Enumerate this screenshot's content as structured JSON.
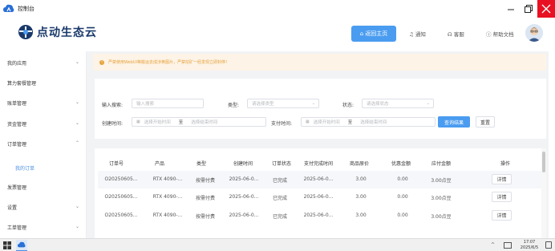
{
  "window": {
    "title": "控制台"
  },
  "header": {
    "logo_text": "点动生态云",
    "home_label": "返回主页",
    "notify_label": "通知",
    "service_label": "客服",
    "help_label": "帮助文档"
  },
  "sidebar": {
    "items": [
      {
        "label": "我的应用",
        "chevron": "⌄"
      },
      {
        "label": "算力套餐管理",
        "chevron": ""
      },
      {
        "label": "账单管理",
        "chevron": "⌄"
      },
      {
        "label": "资金管理",
        "chevron": "⌄"
      },
      {
        "label": "订单管理",
        "chevron": "⌃"
      },
      {
        "label": "我的订单",
        "chevron": ""
      },
      {
        "label": "发票管理",
        "chevron": ""
      },
      {
        "label": "设置",
        "chevron": "⌄"
      },
      {
        "label": "工单管理",
        "chevron": "⌄"
      }
    ]
  },
  "notice": {
    "text": "严禁使用WebUI等搬运去成涉黄图片，严禁挖矿一经发现立即封停！"
  },
  "filter": {
    "input_search_label": "输入搜索:",
    "input_search_placeholder": "输入搜索",
    "type_label": "类型:",
    "type_placeholder": "请选择类型",
    "status_label": "状态:",
    "status_placeholder": "请选择状态",
    "create_time_label": "创建时间:",
    "start_placeholder": "选择开始时间",
    "to_label": "至",
    "end_placeholder": "选择结束时间",
    "pay_time_label": "支付时间:",
    "query_label": "查询结果",
    "reset_label": "重置"
  },
  "table": {
    "headers": [
      "订单号",
      "产品",
      "类型",
      "创建时间",
      "订单状态",
      "支付完成时间",
      "商品原价",
      "优惠金额",
      "应付金额",
      "操作"
    ],
    "rows": [
      [
        "O20250605...",
        "RTX 4090-...",
        "按需付费",
        "2025-06-0...",
        "已完成",
        "2025-06-0...",
        "3.00",
        "0.00",
        "3.00点豆",
        "详情"
      ],
      [
        "O20250605...",
        "RTX 4090-...",
        "按需付费",
        "2025-06-0...",
        "已完成",
        "2025-06-0...",
        "3.00",
        "0.00",
        "3.00点豆",
        "详情"
      ],
      [
        "O20250605...",
        "RTX 4090-...",
        "按需付费",
        "2025-06-0...",
        "已完成",
        "2025-06-0...",
        "3.00",
        "0.00",
        "3.00点豆",
        "详情"
      ]
    ]
  },
  "taskbar": {
    "time": "17:07",
    "date": "2025/6/5",
    "tray_arrow": "^"
  },
  "colors": {
    "primary": "#4a9cf0",
    "close": "#e81123",
    "warning": "#e6a23c",
    "link": "#4a90e2"
  },
  "icons": [
    "cloud-app-icon",
    "minimize-icon",
    "maximize-icon",
    "close-icon",
    "home-icon",
    "bell-icon",
    "headset-icon",
    "help-icon",
    "avatar",
    "warning-icon",
    "calendar-icon",
    "windows-start-icon"
  ]
}
